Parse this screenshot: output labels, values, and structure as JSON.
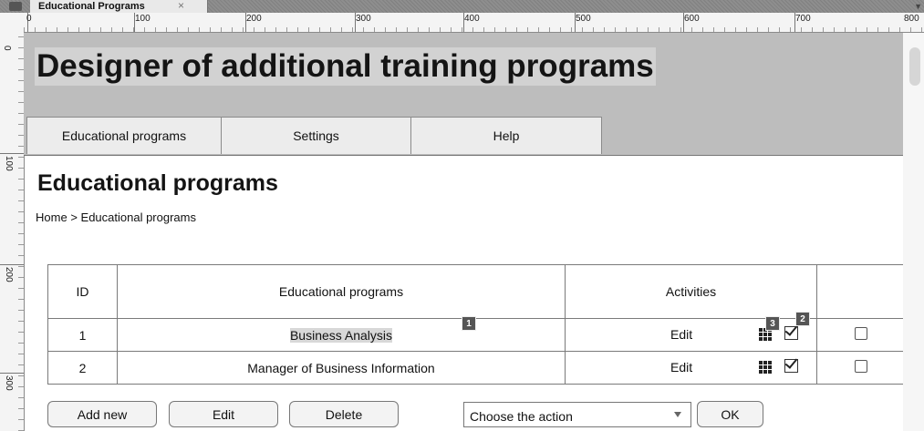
{
  "tab": {
    "title": "Educational Programs",
    "close_glyph": "×"
  },
  "ruler": {
    "h_ticks": [
      "0",
      "100",
      "200",
      "300",
      "400",
      "500",
      "600",
      "700",
      "800"
    ],
    "v_ticks": [
      "0",
      "100",
      "200",
      "300"
    ]
  },
  "header": {
    "title": "Designer of additional training programs",
    "nav": [
      "Educational programs",
      "Settings",
      "Help"
    ]
  },
  "section": {
    "title": "Educational programs"
  },
  "breadcrumb": {
    "home": "Home",
    "separator": ">",
    "current": "Educational programs"
  },
  "table": {
    "headers": {
      "id": "ID",
      "program": "Educational programs",
      "activities": "Activities"
    },
    "rows": [
      {
        "id": "1",
        "program": "Business Analysis",
        "edit": "Edit"
      },
      {
        "id": "2",
        "program": "Manager of Business Information",
        "edit": "Edit"
      }
    ]
  },
  "markers": {
    "m1": "1",
    "m2": "2",
    "m3": "3"
  },
  "buttons": {
    "add_new": "Add new",
    "edit": "Edit",
    "delete": "Delete",
    "ok": "OK"
  },
  "action_select": {
    "selected": "Choose the action"
  }
}
